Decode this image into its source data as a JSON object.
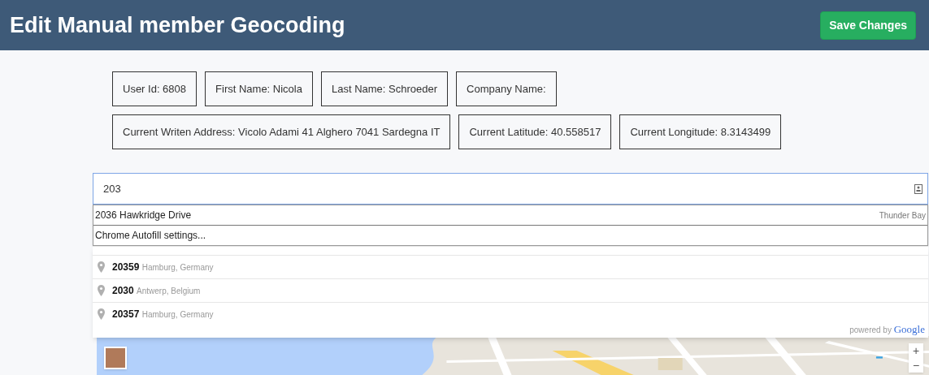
{
  "header": {
    "title": "Edit Manual member Geocoding",
    "save_button": "Save Changes"
  },
  "info_rows": [
    [
      "User Id: 6808",
      "First Name: Nicola",
      "Last Name: Schroeder",
      "Company Name:"
    ],
    [
      "Current Writen Address: Vicolo Adami 41 Alghero 7041 Sardegna IT",
      "Current Latitude: 40.558517",
      "Current Longitude: 8.3143499"
    ]
  ],
  "search": {
    "value": "203"
  },
  "autofill": {
    "suggestion": "2036 Hawkridge Drive",
    "suggestion_detail": "Thunder Bay",
    "settings": "Chrome Autofill settings..."
  },
  "places": [
    {
      "main": "20359",
      "secondary": "Hamburg, Germany"
    },
    {
      "main": "2030",
      "secondary": "Antwerp, Belgium"
    },
    {
      "main": "20357",
      "secondary": "Hamburg, Germany"
    }
  ],
  "attribution": {
    "prefix": "powered by",
    "logo": "Google"
  },
  "map": {
    "kind": "picture",
    "zoom_controls": [
      "+",
      "−"
    ]
  }
}
